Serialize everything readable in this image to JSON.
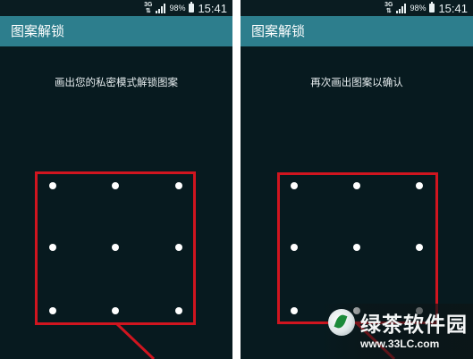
{
  "status_bar": {
    "network": "3G",
    "battery_percent": "98%",
    "time": "15:41"
  },
  "app_title": "图案解锁",
  "screens": [
    {
      "instruction": "画出您的私密模式解锁图案"
    },
    {
      "instruction": "再次画出图案以确认"
    }
  ],
  "pattern_grid": {
    "rows": 3,
    "cols": 3
  },
  "watermark": {
    "name": "绿茶软件园",
    "url": "www.33LC.com"
  },
  "colors": {
    "title_bar": "#2d7e8d",
    "background": "#071a1f",
    "highlight": "#d0151f"
  }
}
